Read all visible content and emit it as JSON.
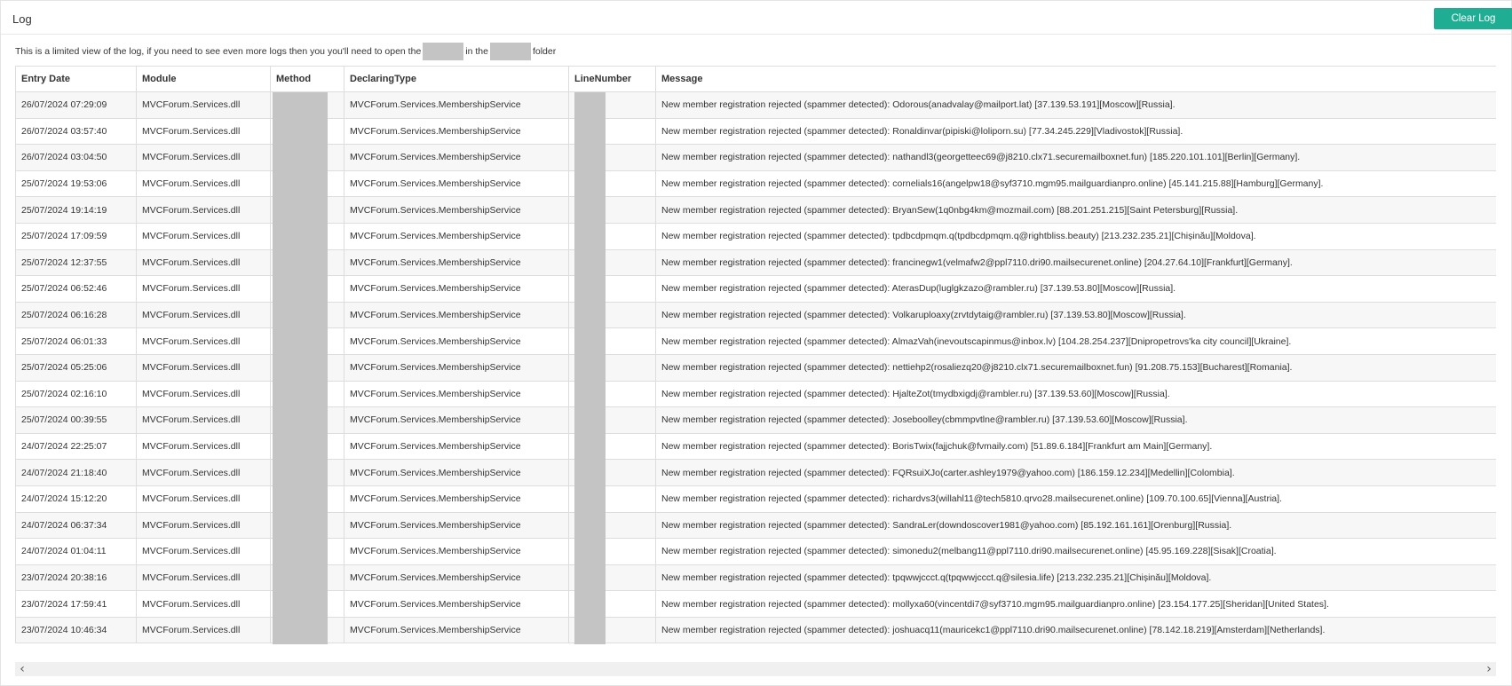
{
  "panel": {
    "title": "Log",
    "clear_button": "Clear Log"
  },
  "info": {
    "before": "This is a limited view of the log, if you need to see even more logs then you you'll need to open the",
    "middle": "in the",
    "after": "folder"
  },
  "table": {
    "columns": [
      "Entry Date",
      "Module",
      "Method",
      "DeclaringType",
      "LineNumber",
      "Message"
    ],
    "rows": [
      {
        "date": "26/07/2024 07:29:09",
        "module": "MVCForum.Services.dll",
        "method": "",
        "declaring_type": "MVCForum.Services.MembershipService",
        "line": "",
        "message": "New member registration rejected (spammer detected): Odorous(anadvalay@mailport.lat) [37.139.53.191][Moscow][Russia]."
      },
      {
        "date": "26/07/2024 03:57:40",
        "module": "MVCForum.Services.dll",
        "method": "",
        "declaring_type": "MVCForum.Services.MembershipService",
        "line": "",
        "message": "New member registration rejected (spammer detected): Ronaldinvar(pipiski@loliporn.su) [77.34.245.229][Vladivostok][Russia]."
      },
      {
        "date": "26/07/2024 03:04:50",
        "module": "MVCForum.Services.dll",
        "method": "",
        "declaring_type": "MVCForum.Services.MembershipService",
        "line": "",
        "message": "New member registration rejected (spammer detected): nathandl3(georgetteec69@j8210.clx71.securemailboxnet.fun) [185.220.101.101][Berlin][Germany]."
      },
      {
        "date": "25/07/2024 19:53:06",
        "module": "MVCForum.Services.dll",
        "method": "",
        "declaring_type": "MVCForum.Services.MembershipService",
        "line": "",
        "message": "New member registration rejected (spammer detected): cornelials16(angelpw18@syf3710.mgm95.mailguardianpro.online) [45.141.215.88][Hamburg][Germany]."
      },
      {
        "date": "25/07/2024 19:14:19",
        "module": "MVCForum.Services.dll",
        "method": "",
        "declaring_type": "MVCForum.Services.MembershipService",
        "line": "",
        "message": "New member registration rejected (spammer detected): BryanSew(1q0nbg4km@mozmail.com) [88.201.251.215][Saint Petersburg][Russia]."
      },
      {
        "date": "25/07/2024 17:09:59",
        "module": "MVCForum.Services.dll",
        "method": "",
        "declaring_type": "MVCForum.Services.MembershipService",
        "line": "",
        "message": "New member registration rejected (spammer detected): tpdbcdpmqm.q(tpdbcdpmqm.q@rightbliss.beauty) [213.232.235.21][Chișinău][Moldova]."
      },
      {
        "date": "25/07/2024 12:37:55",
        "module": "MVCForum.Services.dll",
        "method": "",
        "declaring_type": "MVCForum.Services.MembershipService",
        "line": "",
        "message": "New member registration rejected (spammer detected): francinegw1(velmafw2@ppl7110.dri90.mailsecurenet.online) [204.27.64.10][Frankfurt][Germany]."
      },
      {
        "date": "25/07/2024 06:52:46",
        "module": "MVCForum.Services.dll",
        "method": "",
        "declaring_type": "MVCForum.Services.MembershipService",
        "line": "",
        "message": "New member registration rejected (spammer detected): AterasDup(luglgkzazo@rambler.ru) [37.139.53.80][Moscow][Russia]."
      },
      {
        "date": "25/07/2024 06:16:28",
        "module": "MVCForum.Services.dll",
        "method": "",
        "declaring_type": "MVCForum.Services.MembershipService",
        "line": "",
        "message": "New member registration rejected (spammer detected): Volkaruploaxy(zrvtdytaig@rambler.ru) [37.139.53.80][Moscow][Russia]."
      },
      {
        "date": "25/07/2024 06:01:33",
        "module": "MVCForum.Services.dll",
        "method": "",
        "declaring_type": "MVCForum.Services.MembershipService",
        "line": "",
        "message": "New member registration rejected (spammer detected): AlmazVah(inevoutscapinmus@inbox.lv) [104.28.254.237][Dnipropetrovs'ka city council][Ukraine]."
      },
      {
        "date": "25/07/2024 05:25:06",
        "module": "MVCForum.Services.dll",
        "method": "",
        "declaring_type": "MVCForum.Services.MembershipService",
        "line": "",
        "message": "New member registration rejected (spammer detected): nettiehp2(rosaliezq20@j8210.clx71.securemailboxnet.fun) [91.208.75.153][Bucharest][Romania]."
      },
      {
        "date": "25/07/2024 02:16:10",
        "module": "MVCForum.Services.dll",
        "method": "",
        "declaring_type": "MVCForum.Services.MembershipService",
        "line": "",
        "message": "New member registration rejected (spammer detected): HjalteZot(tmydbxigdj@rambler.ru) [37.139.53.60][Moscow][Russia]."
      },
      {
        "date": "25/07/2024 00:39:55",
        "module": "MVCForum.Services.dll",
        "method": "",
        "declaring_type": "MVCForum.Services.MembershipService",
        "line": "",
        "message": "New member registration rejected (spammer detected): Joseboolley(cbmmpvtlne@rambler.ru) [37.139.53.60][Moscow][Russia]."
      },
      {
        "date": "24/07/2024 22:25:07",
        "module": "MVCForum.Services.dll",
        "method": "",
        "declaring_type": "MVCForum.Services.MembershipService",
        "line": "",
        "message": "New member registration rejected (spammer detected): BorisTwix(fajjchuk@fvmaily.com) [51.89.6.184][Frankfurt am Main][Germany]."
      },
      {
        "date": "24/07/2024 21:18:40",
        "module": "MVCForum.Services.dll",
        "method": "",
        "declaring_type": "MVCForum.Services.MembershipService",
        "line": "",
        "message": "New member registration rejected (spammer detected): FQRsuiXJo(carter.ashley1979@yahoo.com) [186.159.12.234][Medellin][Colombia]."
      },
      {
        "date": "24/07/2024 15:12:20",
        "module": "MVCForum.Services.dll",
        "method": "",
        "declaring_type": "MVCForum.Services.MembershipService",
        "line": "",
        "message": "New member registration rejected (spammer detected): richardvs3(willahl11@tech5810.qrvo28.mailsecurenet.online) [109.70.100.65][Vienna][Austria]."
      },
      {
        "date": "24/07/2024 06:37:34",
        "module": "MVCForum.Services.dll",
        "method": "",
        "declaring_type": "MVCForum.Services.MembershipService",
        "line": "",
        "message": "New member registration rejected (spammer detected): SandraLer(downdoscover1981@yahoo.com) [85.192.161.161][Orenburg][Russia]."
      },
      {
        "date": "24/07/2024 01:04:11",
        "module": "MVCForum.Services.dll",
        "method": "",
        "declaring_type": "MVCForum.Services.MembershipService",
        "line": "",
        "message": "New member registration rejected (spammer detected): simonedu2(melbang11@ppl7110.dri90.mailsecurenet.online) [45.95.169.228][Sisak][Croatia]."
      },
      {
        "date": "23/07/2024 20:38:16",
        "module": "MVCForum.Services.dll",
        "method": "",
        "declaring_type": "MVCForum.Services.MembershipService",
        "line": "",
        "message": "New member registration rejected (spammer detected): tpqwwjccct.q(tpqwwjccct.q@silesia.life) [213.232.235.21][Chișinău][Moldova]."
      },
      {
        "date": "23/07/2024 17:59:41",
        "module": "MVCForum.Services.dll",
        "method": "",
        "declaring_type": "MVCForum.Services.MembershipService",
        "line": "",
        "message": "New member registration rejected (spammer detected): mollyxa60(vincentdi7@syf3710.mgm95.mailguardianpro.online) [23.154.177.25][Sheridan][United States]."
      },
      {
        "date": "23/07/2024 10:46:34",
        "module": "MVCForum.Services.dll",
        "method": "",
        "declaring_type": "MVCForum.Services.MembershipService",
        "line": "",
        "message": "New member registration rejected (spammer detected): joshuacq11(mauricekc1@ppl7110.dri90.mailsecurenet.online) [78.142.18.219][Amsterdam][Netherlands]."
      }
    ]
  },
  "scrollbar": {
    "left_icon": "chevron-left-icon",
    "right_icon": "chevron-right-icon"
  }
}
